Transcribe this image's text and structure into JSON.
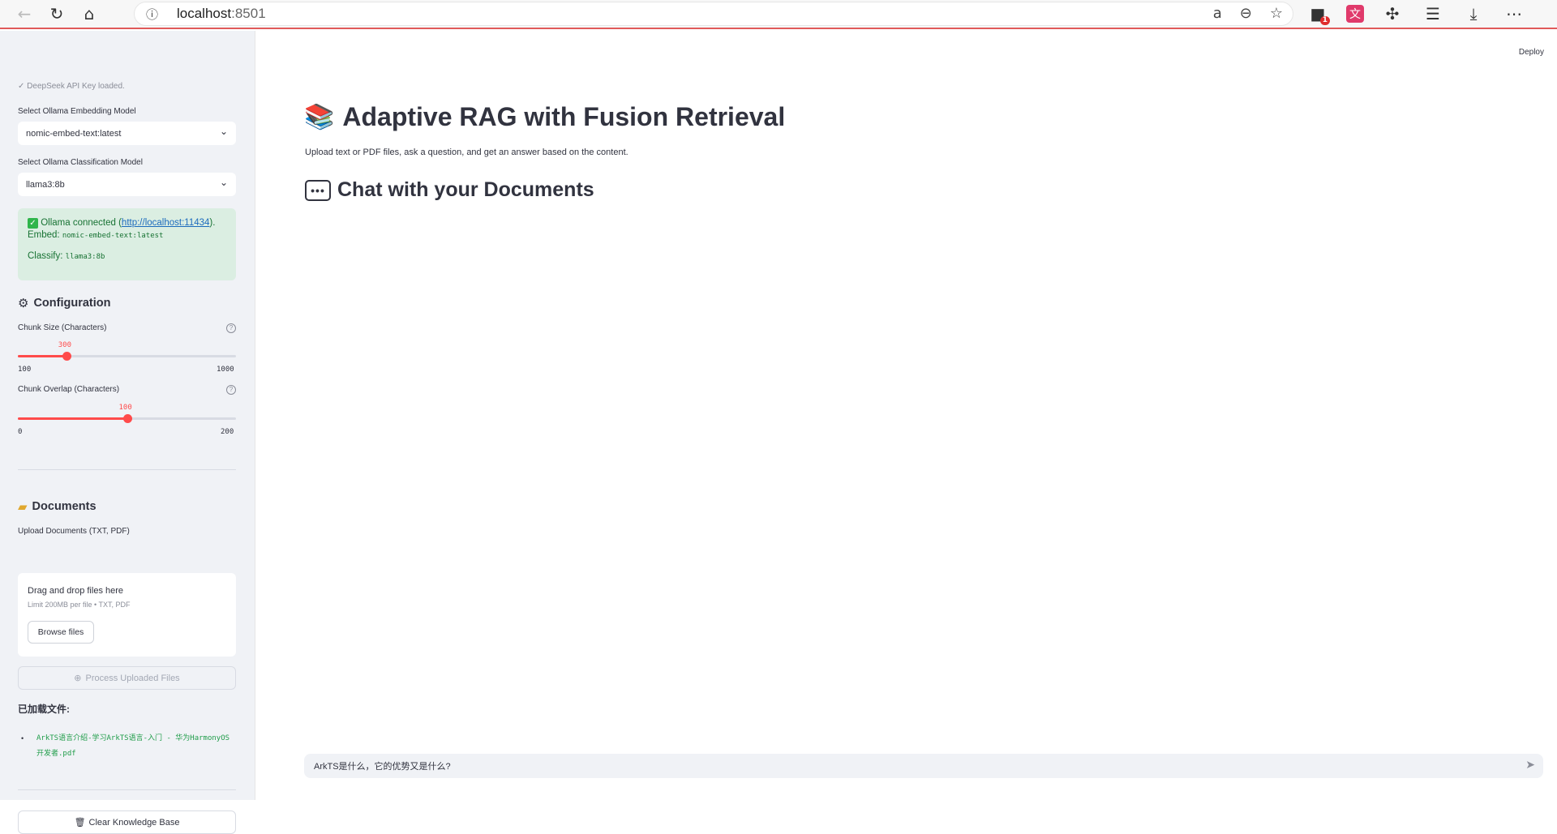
{
  "browser": {
    "url_host": "localhost",
    "url_port": ":8501",
    "extension_badge": "1"
  },
  "sidebar": {
    "api_status": "✓ DeepSeek API Key loaded.",
    "embedding_label": "Select Ollama Embedding Model",
    "embedding_value": "nomic-embed-text:latest",
    "classification_label": "Select Ollama Classification Model",
    "classification_value": "llama3:8b",
    "ollama_status": {
      "prefix": "Ollama connected (",
      "link": "http://localhost:11434",
      "suffix": ").",
      "embed_label": "Embed: ",
      "embed_model": "nomic-embed-text:latest",
      "classify_label": "Classify: ",
      "classify_model": "llama3:8b"
    },
    "configuration_title": "Configuration",
    "chunk_size": {
      "label": "Chunk Size (Characters)",
      "value": 300,
      "min": 100,
      "max": 1000
    },
    "chunk_overlap": {
      "label": "Chunk Overlap (Characters)",
      "value": 100,
      "min": 0,
      "max": 200
    },
    "documents_title": "Documents",
    "upload_label": "Upload Documents (TXT, PDF)",
    "dropzone_title": "Drag and drop files here",
    "dropzone_limit": "Limit 200MB per file • TXT, PDF",
    "browse_label": "Browse files",
    "process_label": "Process Uploaded Files",
    "loaded_files_title": "已加载文件:",
    "loaded_files": [
      "ArkTS语言介绍-学习ArkTS语言-入门 - 华为HarmonyOS开发者.pdf"
    ],
    "clear_label": "Clear Knowledge Base"
  },
  "main": {
    "deploy_label": "Deploy",
    "title": "Adaptive RAG with Fusion Retrieval",
    "subtitle": "Upload text or PDF files, ask a question, and get an answer based on the content.",
    "chat_title": "Chat with your Documents",
    "chat_input_value": "ArkTS是什么，它的优势又是什么?"
  },
  "colors": {
    "accent": "#ff4b4b",
    "success_bg": "#dbeee2",
    "success_text": "#177233",
    "sidebar_bg": "#f0f2f6"
  },
  "icons": {
    "back": "arrow-left-icon",
    "reload": "reload-icon",
    "home": "home-icon",
    "info": "info-icon",
    "read_aloud": "read-aloud-icon",
    "zoom": "zoom-out-icon",
    "favorite": "star-icon",
    "extensions": "puzzle-icon",
    "favorites_list": "favorites-icon",
    "downloads": "download-icon",
    "more": "more-icon",
    "books": "books-icon",
    "chat": "chat-bubble-icon",
    "gear": "gear-icon",
    "folder": "folder-icon",
    "trash": "trash-icon",
    "send": "send-icon"
  }
}
